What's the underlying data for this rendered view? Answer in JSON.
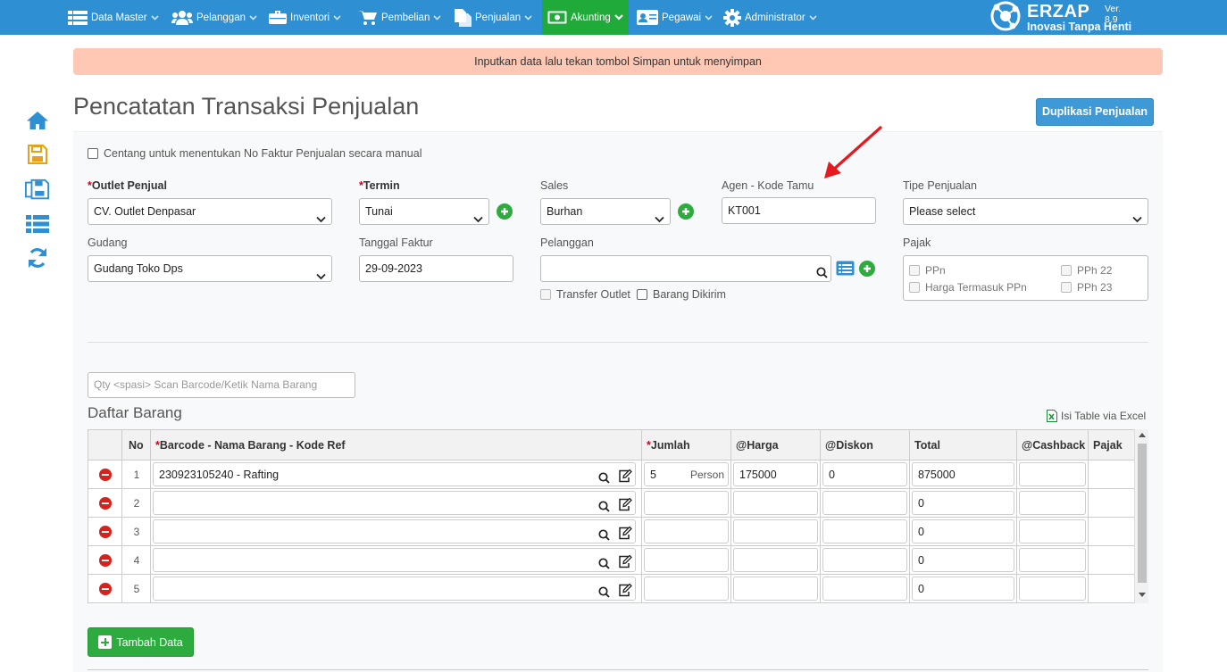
{
  "nav": {
    "items": [
      {
        "label": "Data Master",
        "icon": "list-icon"
      },
      {
        "label": "Pelanggan",
        "icon": "users-icon"
      },
      {
        "label": "Inventori",
        "icon": "briefcase-icon"
      },
      {
        "label": "Pembelian",
        "icon": "cart-icon"
      },
      {
        "label": "Penjualan",
        "icon": "document-icon"
      },
      {
        "label": "Akunting",
        "icon": "money-icon"
      },
      {
        "label": "Pegawai",
        "icon": "id-card-icon"
      },
      {
        "label": "Administrator",
        "icon": "gear-icon"
      }
    ],
    "active": "Akunting",
    "brand_name": "ERZAP",
    "brand_tagline": "Inovasi Tanpa Henti",
    "version": "Ver. 8.9",
    "bar_color": "#2e8fd2",
    "active_color": "#1faa3a"
  },
  "alert": {
    "text": "Inputkan data lalu tekan tombol Simpan untuk menyimpan",
    "color": "#ffc8b4"
  },
  "sidebar": {
    "icons": [
      "home-icon",
      "save-icon",
      "save-as-icon",
      "list-icon",
      "refresh-icon"
    ]
  },
  "page": {
    "title": "Pencatatan Transaksi Penjualan",
    "duplicate_button": "Duplikasi Penjualan"
  },
  "form": {
    "manual_invoice_label": "Centang untuk menentukan No Faktur Penjualan secara manual",
    "outlet": {
      "label": "Outlet Penjual",
      "value": "CV. Outlet Denpasar"
    },
    "termin": {
      "label": "Termin",
      "value": "Tunai"
    },
    "sales": {
      "label": "Sales",
      "value": "Burhan"
    },
    "agen": {
      "label": "Agen - Kode Tamu",
      "value": "KT001"
    },
    "tipe": {
      "label": "Tipe Penjualan",
      "value": "Please select"
    },
    "gudang": {
      "label": "Gudang",
      "value": "Gudang Toko Dps"
    },
    "tanggal": {
      "label": "Tanggal Faktur",
      "value": "29-09-2023"
    },
    "pelanggan": {
      "label": "Pelanggan",
      "value": ""
    },
    "transfer_outlet": "Transfer Outlet",
    "barang_dikirim": "Barang Dikirim",
    "pajak": {
      "label": "Pajak",
      "options": [
        "PPn",
        "PPh 22",
        "Harga Termasuk PPn",
        "PPh 23"
      ]
    }
  },
  "items": {
    "scan_placeholder": "Qty <spasi> Scan Barcode/Ketik Nama Barang",
    "section_title": "Daftar Barang",
    "excel_link": "Isi Table via Excel",
    "columns": [
      "No",
      "Barcode - Nama Barang - Kode Ref",
      "Jumlah",
      "@Harga",
      "@Diskon",
      "Total",
      "@Cashback",
      "Pajak"
    ],
    "rows": [
      {
        "no": "1",
        "barang": "230923105240 - Rafting",
        "jumlah": "5",
        "unit": "Person",
        "harga": "175000",
        "diskon": "0",
        "total": "875000",
        "cashback": ""
      },
      {
        "no": "2",
        "barang": "",
        "jumlah": "",
        "unit": "",
        "harga": "",
        "diskon": "",
        "total": "0",
        "cashback": ""
      },
      {
        "no": "3",
        "barang": "",
        "jumlah": "",
        "unit": "",
        "harga": "",
        "diskon": "",
        "total": "0",
        "cashback": ""
      },
      {
        "no": "4",
        "barang": "",
        "jumlah": "",
        "unit": "",
        "harga": "",
        "diskon": "",
        "total": "0",
        "cashback": ""
      },
      {
        "no": "5",
        "barang": "",
        "jumlah": "",
        "unit": "",
        "harga": "",
        "diskon": "",
        "total": "0",
        "cashback": ""
      }
    ],
    "add_button": "Tambah Data"
  }
}
